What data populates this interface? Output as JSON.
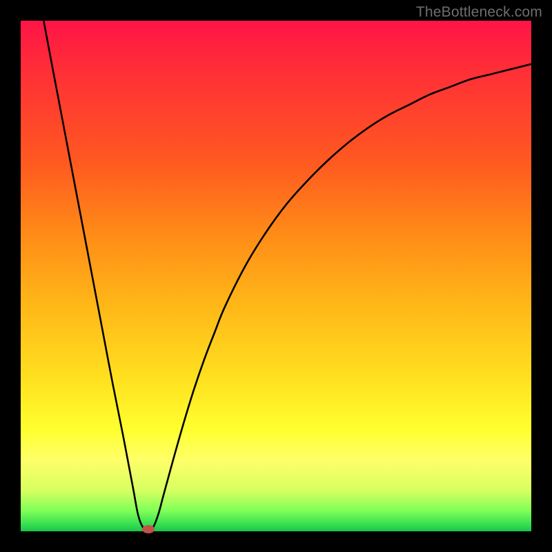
{
  "watermark": "TheBottleneck.com",
  "chart_data": {
    "type": "line",
    "title": "",
    "xlabel": "",
    "ylabel": "",
    "xlim": [
      0,
      100
    ],
    "ylim": [
      0,
      100
    ],
    "series": [
      {
        "name": "curve",
        "x": [
          4.5,
          6,
          8,
          10,
          12,
          14,
          16,
          18,
          20,
          22,
          23,
          24,
          25,
          26,
          27,
          28,
          30,
          32,
          34,
          36,
          38,
          40,
          44,
          48,
          52,
          56,
          60,
          64,
          68,
          72,
          76,
          80,
          84,
          88,
          92,
          96,
          100
        ],
        "y": [
          100,
          92,
          81.5,
          71,
          60.5,
          50,
          39.5,
          29,
          19,
          8.5,
          3.2,
          0.7,
          0,
          0.9,
          3.5,
          7.2,
          14.5,
          21.5,
          28,
          33.8,
          39,
          44,
          52,
          58.5,
          64,
          68.5,
          72.5,
          76,
          79,
          81.5,
          83.5,
          85.5,
          87,
          88.5,
          89.5,
          90.5,
          91.5
        ]
      }
    ],
    "marker": {
      "x": 25,
      "y": 0,
      "color": "#c0544b"
    },
    "gradient_stops": [
      {
        "pos": 0,
        "color": "#ff1447"
      },
      {
        "pos": 28,
        "color": "#ff5a20"
      },
      {
        "pos": 55,
        "color": "#ffb518"
      },
      {
        "pos": 80,
        "color": "#ffff2e"
      },
      {
        "pos": 96,
        "color": "#7eff58"
      },
      {
        "pos": 100,
        "color": "#1bc24a"
      }
    ]
  }
}
